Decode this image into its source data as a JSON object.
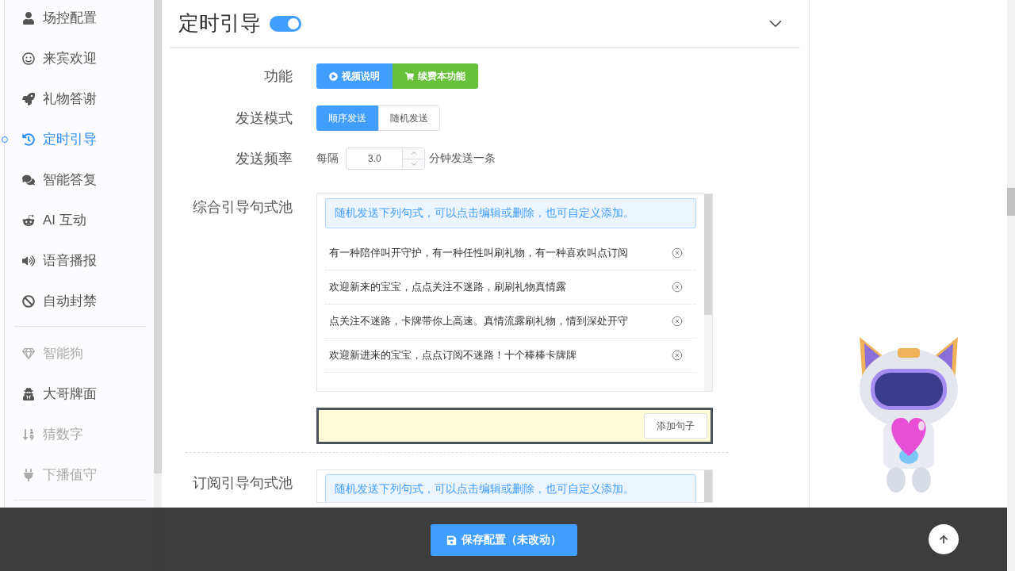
{
  "sidebar": {
    "groups": [
      {
        "items": [
          {
            "label": "场控配置",
            "selected": false,
            "disabled": false
          },
          {
            "label": "来宾欢迎",
            "selected": false,
            "disabled": false
          },
          {
            "label": "礼物答谢",
            "selected": false,
            "disabled": false
          },
          {
            "label": "定时引导",
            "selected": true,
            "disabled": false
          },
          {
            "label": "智能答复",
            "selected": false,
            "disabled": false
          },
          {
            "label": "AI 互动",
            "selected": false,
            "disabled": false
          },
          {
            "label": "语音播报",
            "selected": false,
            "disabled": false
          },
          {
            "label": "自动封禁",
            "selected": false,
            "disabled": false
          }
        ]
      },
      {
        "items": [
          {
            "label": "智能狗",
            "selected": false,
            "disabled": true
          },
          {
            "label": "大哥牌面",
            "selected": false,
            "disabled": false
          },
          {
            "label": "猜数字",
            "selected": false,
            "disabled": true
          },
          {
            "label": "下播值守",
            "selected": false,
            "disabled": true
          }
        ]
      }
    ]
  },
  "panel": {
    "title": "定时引导",
    "enabled": true
  },
  "form": {
    "function": {
      "label": "功能",
      "buttons": [
        {
          "kind": "video",
          "label": "视频说明"
        },
        {
          "kind": "renew",
          "label": "续费本功能"
        }
      ]
    },
    "mode": {
      "label": "发送模式",
      "options": [
        {
          "label": "顺序发送",
          "selected": true
        },
        {
          "label": "随机发送",
          "selected": false
        }
      ]
    },
    "frequency": {
      "label": "发送频率",
      "prefix": "每隔",
      "value": "3.0",
      "suffix": "分钟发送一条"
    }
  },
  "pools": [
    {
      "label": "综合引导句式池",
      "hint": "随机发送下列句式，可以点击编辑或删除，也可自定义添加。",
      "sentences": [
        "有一种陪伴叫开守护，有一种任性叫刷礼物，有一种喜欢叫点订阅",
        "欢迎新来的宝宝，点点关注不迷路，刷刷礼物真情露",
        "点关注不迷路，卡牌带你上高速。真情流露刷礼物，情到深处开守",
        "欢迎新进来的宝宝，点点订阅不迷路！十个棒棒卡牌牌"
      ],
      "add_button": "添加句子"
    },
    {
      "label": "订阅引导句式池",
      "hint": "随机发送下列句式，可以点击编辑或删除，也可自定义添加。"
    }
  ],
  "save_button": "保存配置（未改动）"
}
